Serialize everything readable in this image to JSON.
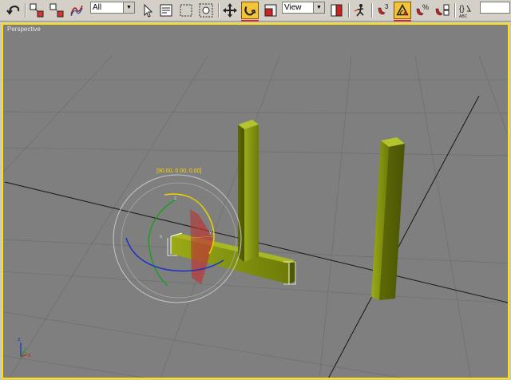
{
  "toolbar": {
    "selection_filter": "All",
    "ref_coord_system": "View",
    "named_selection": "",
    "tools": [
      {
        "name": "undo-icon"
      },
      {
        "name": "select-and-link-icon"
      },
      {
        "name": "unlink-selection-icon"
      },
      {
        "name": "bind-to-space-warp-icon"
      },
      {
        "name": "select-object-icon"
      },
      {
        "name": "select-by-name-icon"
      },
      {
        "name": "rectangular-selection-region-icon"
      },
      {
        "name": "window-crossing-icon"
      },
      {
        "name": "select-and-move-icon"
      },
      {
        "name": "select-and-rotate-icon"
      },
      {
        "name": "select-and-scale-icon"
      },
      {
        "name": "use-pivot-point-center-icon"
      },
      {
        "name": "select-and-manipulate-icon"
      },
      {
        "name": "snaps-toggle-icon"
      },
      {
        "name": "angle-snap-toggle-icon"
      },
      {
        "name": "percent-snap-toggle-icon"
      },
      {
        "name": "spinner-snap-toggle-icon"
      },
      {
        "name": "edit-named-selections-icon"
      }
    ],
    "active_tools": [
      "select-and-rotate",
      "angle-snap-toggle"
    ],
    "snaps_label": "3",
    "percent_label": "%"
  },
  "viewport": {
    "label": "Perspective",
    "rotate_readout": "[90.00, 0.00, 0.00]",
    "border_color": "#ffe000",
    "background_color": "#7f7f7f",
    "object_color": "#8a9a10",
    "axis_tripod": {
      "x": "x",
      "y": "y",
      "z": "z"
    },
    "gizmo_axes": {
      "x": "x",
      "y": "y",
      "z": "z"
    }
  }
}
